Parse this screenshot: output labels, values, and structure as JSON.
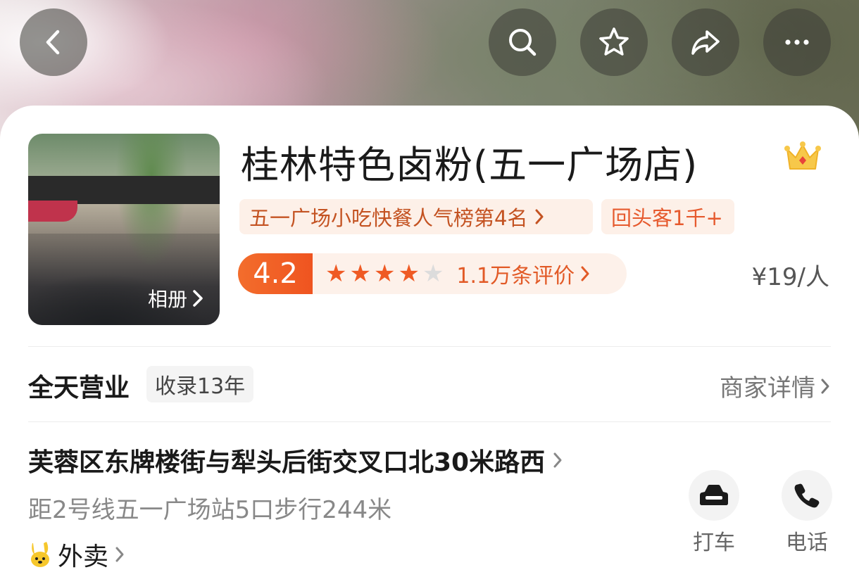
{
  "header": {
    "back_icon": "chevron-left-icon",
    "actions": [
      "search-icon",
      "star-icon",
      "share-icon",
      "more-icon"
    ]
  },
  "shop": {
    "album_label": "相册",
    "name": "桂林特色卤粉(五一广场店)",
    "rank_tag": "五一广场小吃快餐人气榜第4名",
    "repeat_tag": "回头客1千+",
    "score": "4.2",
    "stars_value": 4,
    "stars_total": 5,
    "reviews": "1.1万条评价",
    "price": "¥19/人",
    "hours": "全天营业",
    "listed_years": "收录13年",
    "merchant_detail": "商家详情",
    "address": "芙蓉区东牌楼街与犁头后街交叉口北30米路西",
    "distance": "距2号线五一广场站5口步行244米",
    "delivery": "外卖"
  },
  "actions": {
    "taxi": "打车",
    "phone": "电话"
  },
  "colors": {
    "accent": "#ef5a24",
    "tag_bg": "#fdf0e8",
    "star_filled": "#ef5a24",
    "star_empty": "#dcdcdc"
  }
}
